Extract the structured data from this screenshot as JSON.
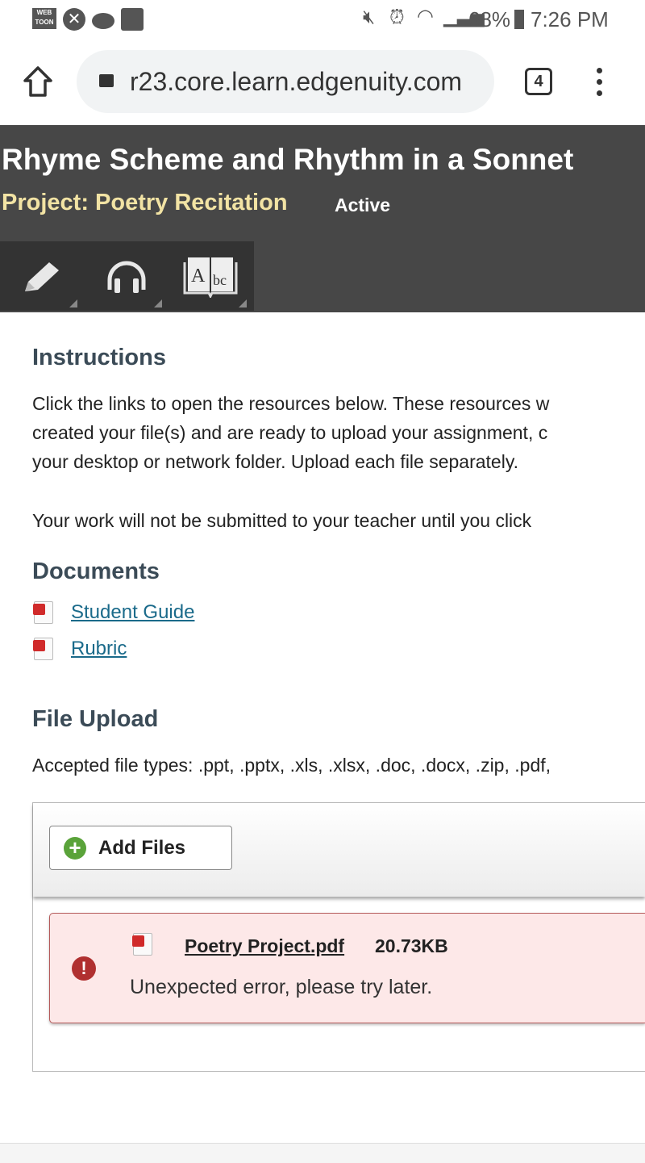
{
  "status_bar": {
    "left_icons": [
      "webtoon-icon",
      "xbox-icon",
      "reddit-icon",
      "app-icon"
    ],
    "battery": "68%",
    "time": "7:26 PM"
  },
  "browser": {
    "url": "r23.core.learn.edgenuity.com",
    "tab_count": "4"
  },
  "header": {
    "title": "Rhyme Scheme and Rhythm in a Sonnet",
    "subtitle": "Project: Poetry Recitation",
    "status": "Active",
    "tools": [
      "pencil-icon",
      "headphones-icon",
      "dictionary-icon"
    ]
  },
  "instructions": {
    "heading": "Instructions",
    "lines": [
      "Click the links to open the resources below. These resources w",
      "created your file(s) and are ready to upload your assignment, c",
      "your desktop or network folder. Upload each file separately."
    ],
    "note": "Your work will not be submitted to your teacher until you click"
  },
  "documents": {
    "heading": "Documents",
    "items": [
      {
        "label": "Student Guide"
      },
      {
        "label": "Rubric"
      }
    ]
  },
  "upload": {
    "heading": "File Upload",
    "accepted": "Accepted file types: .ppt, .pptx, .xls, .xlsx, .doc, .docx, .zip, .pdf,",
    "add_files": "Add Files",
    "file": {
      "name": "Poetry Project.pdf",
      "size": "20.73KB",
      "error": "Unexpected error, please try later."
    }
  },
  "colors": {
    "header_bg": "#474747",
    "subtitle": "#f2e3a4",
    "heading": "#3b4b57",
    "link": "#1a6a8a",
    "error_bg": "#fde8e8",
    "error_icon": "#b03030"
  }
}
